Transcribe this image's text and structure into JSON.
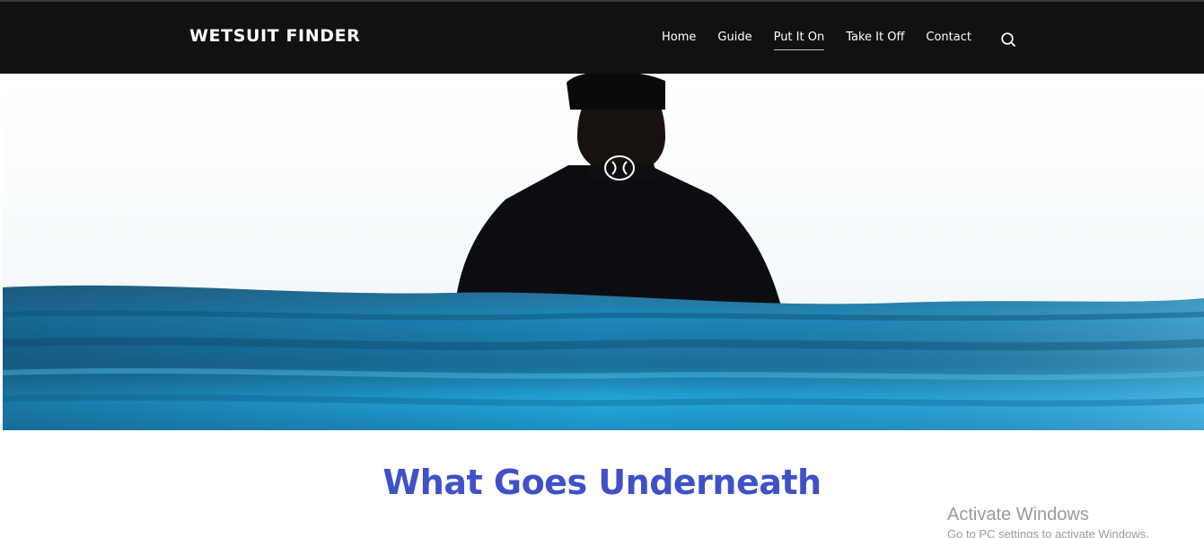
{
  "header": {
    "brand": "WETSUIT FINDER",
    "nav": [
      {
        "label": "Home",
        "active": false
      },
      {
        "label": "Guide",
        "active": false
      },
      {
        "label": "Put It On",
        "active": true
      },
      {
        "label": "Take It Off",
        "active": false
      },
      {
        "label": "Contact",
        "active": false
      }
    ],
    "search_icon": "search-icon"
  },
  "hero": {
    "image": "surfer-in-wetsuit-standing-in-ocean"
  },
  "main": {
    "title": "What Goes Underneath"
  },
  "watermark": {
    "title": "Activate Windows",
    "subtitle": "Go to PC settings to activate Windows."
  },
  "colors": {
    "header_bg": "#111111",
    "title": "#3f51c7",
    "water": "#1f8fbf"
  }
}
